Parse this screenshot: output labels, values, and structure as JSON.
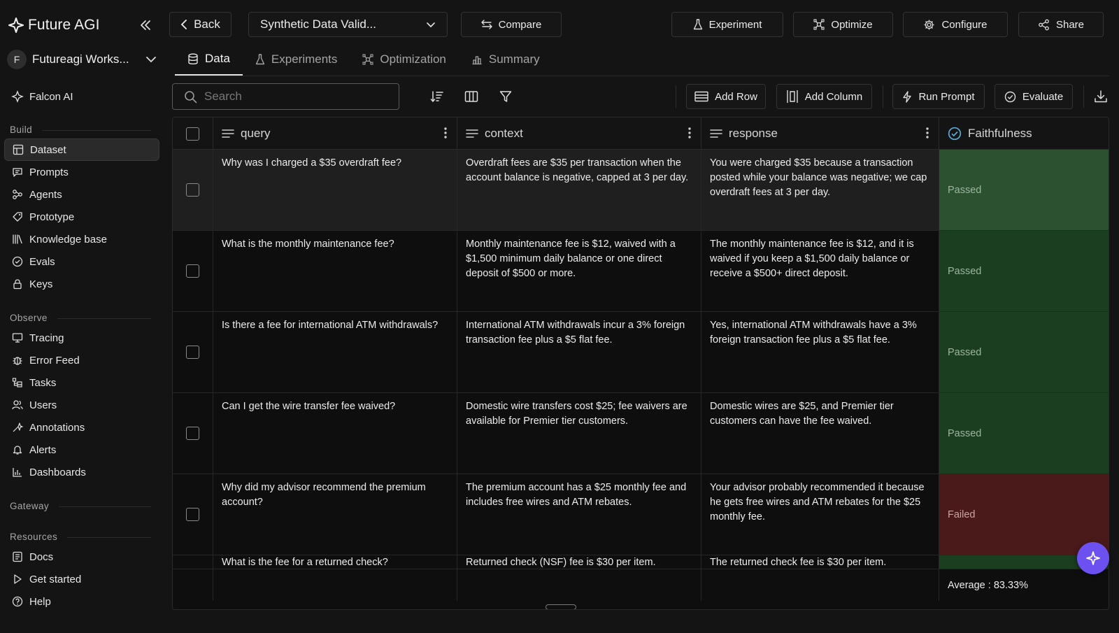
{
  "brand": {
    "name": "Future AGI"
  },
  "workspace": {
    "initial": "F",
    "name": "Futureagi Works..."
  },
  "sidebar": {
    "top_item": "Falcon AI",
    "sections": {
      "build": "Build",
      "observe": "Observe",
      "gateway": "Gateway",
      "resources": "Resources"
    },
    "build_items": [
      "Dataset",
      "Prompts",
      "Agents",
      "Prototype",
      "Knowledge base",
      "Evals",
      "Keys"
    ],
    "observe_items": [
      "Tracing",
      "Error Feed",
      "Tasks",
      "Users",
      "Annotations",
      "Alerts",
      "Dashboards"
    ],
    "resource_items": [
      "Docs",
      "Get started",
      "Help"
    ]
  },
  "topbar": {
    "back": "Back",
    "dataset_name": "Synthetic Data Valid...",
    "compare": "Compare",
    "experiment": "Experiment",
    "optimize": "Optimize",
    "configure": "Configure",
    "share": "Share"
  },
  "tabs": [
    "Data",
    "Experiments",
    "Optimization",
    "Summary"
  ],
  "actions": {
    "search_placeholder": "Search",
    "add_row": "Add Row",
    "add_column": "Add Column",
    "run_prompt": "Run Prompt",
    "evaluate": "Evaluate"
  },
  "table": {
    "columns": [
      "query",
      "context",
      "response",
      "Faithfulness"
    ],
    "rows": [
      {
        "query": "Why was I charged a $35 overdraft fee?",
        "context": "Overdraft fees are $35 per transaction when the account balance is negative, capped at 3 per day.",
        "response": "You were charged $35 because a transaction posted while your balance was negative; we cap overdraft fees at 3 per day.",
        "faithfulness": "Passed"
      },
      {
        "query": "What is the monthly maintenance fee?",
        "context": "Monthly maintenance fee is $12, waived with a $1,500 minimum daily balance or one direct deposit of $500 or more.",
        "response": "The monthly maintenance fee is $12, and it is waived if you keep a $1,500 daily balance or receive a $500+ direct deposit.",
        "faithfulness": "Passed"
      },
      {
        "query": "Is there a fee for international ATM withdrawals?",
        "context": "International ATM withdrawals incur a 3% foreign transaction fee plus a $5 flat fee.",
        "response": "Yes, international ATM withdrawals have a 3% foreign transaction fee plus a $5 flat fee.",
        "faithfulness": "Passed"
      },
      {
        "query": "Can I get the wire transfer fee waived?",
        "context": "Domestic wire transfers cost $25; fee waivers are available for Premier tier customers.",
        "response": "Domestic wires are $25, and Premier tier customers can have the fee waived.",
        "faithfulness": "Passed"
      },
      {
        "query": "Why did my advisor recommend the premium account?",
        "context": "The premium account has a $25 monthly fee and includes free wires and ATM rebates.",
        "response": "Your advisor probably recommended it because he gets free wires and ATM rebates for the $25 monthly fee.",
        "faithfulness": "Failed"
      },
      {
        "query": "What is the fee for a returned check?",
        "context": "Returned check (NSF) fee is $30 per item.",
        "response": "The returned check fee is $30 per item.",
        "faithfulness": ""
      }
    ],
    "average": "Average : 83.33%"
  },
  "colors": {
    "pass": "#1b3d20",
    "fail": "#4a1a1a",
    "accent": "#6d50f0",
    "check": "#5aa9d6"
  }
}
